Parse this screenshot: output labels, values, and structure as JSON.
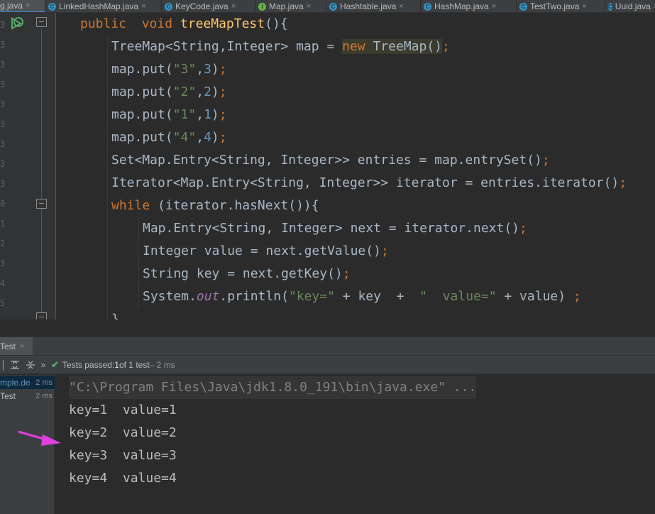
{
  "tabs": [
    {
      "label": "g.java",
      "icon": "java-file-icon",
      "active": true
    },
    {
      "label": "LinkedHashMap.java",
      "icon": "class-icon"
    },
    {
      "label": "KeyCode.java",
      "icon": "class-icon"
    },
    {
      "label": "Map.java",
      "icon": "interface-icon"
    },
    {
      "label": "Hashtable.java",
      "icon": "class-icon"
    },
    {
      "label": "HashMap.java",
      "icon": "class-icon"
    },
    {
      "label": "TestTwo.java",
      "icon": "class-icon"
    },
    {
      "label": "Uuid.java",
      "icon": "class-icon"
    }
  ],
  "tab_close_glyph": "×",
  "gutter": {
    "line_number_fragments": [
      "3",
      "3",
      "3",
      "3",
      "3",
      "3",
      "3",
      "3",
      "3",
      "0",
      "1",
      "2",
      "3",
      "4",
      "5",
      "6"
    ]
  },
  "editor": {
    "lines": [
      {
        "indent": 0,
        "html_parts": [
          [
            "kw",
            "public  void "
          ],
          [
            "fn",
            "treeMapTest"
          ],
          [
            "",
            "()"
          ],
          [
            "",
            "{"
          ]
        ]
      },
      {
        "indent": 1,
        "html_parts": [
          [
            "",
            "TreeMap<String,Integer> map = "
          ],
          [
            "kw hl",
            "new "
          ],
          [
            "hl",
            "TreeMap()"
          ],
          [
            "semi",
            ";"
          ]
        ]
      },
      {
        "indent": 1,
        "html_parts": [
          [
            "",
            "map.put("
          ],
          [
            "str",
            "\"3\""
          ],
          [
            "",
            ","
          ],
          [
            "num",
            "3"
          ],
          [
            "",
            ")"
          ],
          [
            "semi",
            ";"
          ]
        ]
      },
      {
        "indent": 1,
        "html_parts": [
          [
            "",
            "map.put("
          ],
          [
            "str",
            "\"2\""
          ],
          [
            "",
            ","
          ],
          [
            "num",
            "2"
          ],
          [
            "",
            ")"
          ],
          [
            "semi",
            ";"
          ]
        ]
      },
      {
        "indent": 1,
        "html_parts": [
          [
            "",
            "map.put("
          ],
          [
            "str",
            "\"1\""
          ],
          [
            "",
            ","
          ],
          [
            "num",
            "1"
          ],
          [
            "",
            ")"
          ],
          [
            "semi",
            ";"
          ]
        ]
      },
      {
        "indent": 1,
        "html_parts": [
          [
            "",
            "map.put("
          ],
          [
            "str",
            "\"4\""
          ],
          [
            "",
            ","
          ],
          [
            "num",
            "4"
          ],
          [
            "",
            ")"
          ],
          [
            "semi",
            ";"
          ]
        ]
      },
      {
        "indent": 1,
        "html_parts": [
          [
            "",
            "Set<Map.Entry<String, Integer>> entries = map.entrySet()"
          ],
          [
            "semi",
            ";"
          ]
        ]
      },
      {
        "indent": 1,
        "html_parts": [
          [
            "",
            "Iterator<Map.Entry<String, Integer>> iterator = entries.iterator()"
          ],
          [
            "semi",
            ";"
          ]
        ]
      },
      {
        "indent": 1,
        "html_parts": [
          [
            "kw",
            "while "
          ],
          [
            "",
            "(iterator.hasNext()){"
          ]
        ]
      },
      {
        "indent": 2,
        "html_parts": [
          [
            "",
            "Map.Entry<String, Integer> next = iterator.next()"
          ],
          [
            "semi",
            ";"
          ]
        ]
      },
      {
        "indent": 2,
        "html_parts": [
          [
            "",
            "Integer value = next.getValue()"
          ],
          [
            "semi",
            ";"
          ]
        ]
      },
      {
        "indent": 2,
        "html_parts": [
          [
            "",
            "String key = next.getKey()"
          ],
          [
            "semi",
            ";"
          ]
        ]
      },
      {
        "indent": 2,
        "html_parts": [
          [
            "",
            "System."
          ],
          [
            "stat",
            "out"
          ],
          [
            "",
            ".println("
          ],
          [
            "str",
            "\"key=\""
          ],
          [
            "",
            " + key  +  "
          ],
          [
            "str",
            "\"  value=\""
          ],
          [
            "",
            " + value) "
          ],
          [
            "semi",
            ";"
          ]
        ]
      },
      {
        "indent": 1,
        "html_parts": [
          [
            "",
            "}"
          ]
        ]
      }
    ]
  },
  "run_panel": {
    "tab_label": "Test",
    "status_prefix": "Tests passed: ",
    "status_count": "1",
    "status_suffix": " of 1 test",
    "status_time": " – 2 ms",
    "tree": [
      {
        "name": "mple.de",
        "duration": "2 ms",
        "selected": true
      },
      {
        "name": "Test",
        "duration": "2 ms",
        "selected": false
      }
    ],
    "console": [
      {
        "text": "\"C:\\Program Files\\Java\\jdk1.8.0_191\\bin\\java.exe\" ...",
        "kind": "cmd"
      },
      {
        "text": "key=1  value=1",
        "kind": "out"
      },
      {
        "text": "key=2  value=2",
        "kind": "out"
      },
      {
        "text": "key=3  value=3",
        "kind": "out"
      },
      {
        "text": "key=4  value=4",
        "kind": "out"
      }
    ]
  },
  "colors": {
    "keyword": "#cc7832",
    "string": "#6a8759",
    "number": "#6897bb",
    "method_decl": "#ffc66d",
    "annotation_arrow": "#e040e0",
    "pass_check": "#59a869"
  }
}
